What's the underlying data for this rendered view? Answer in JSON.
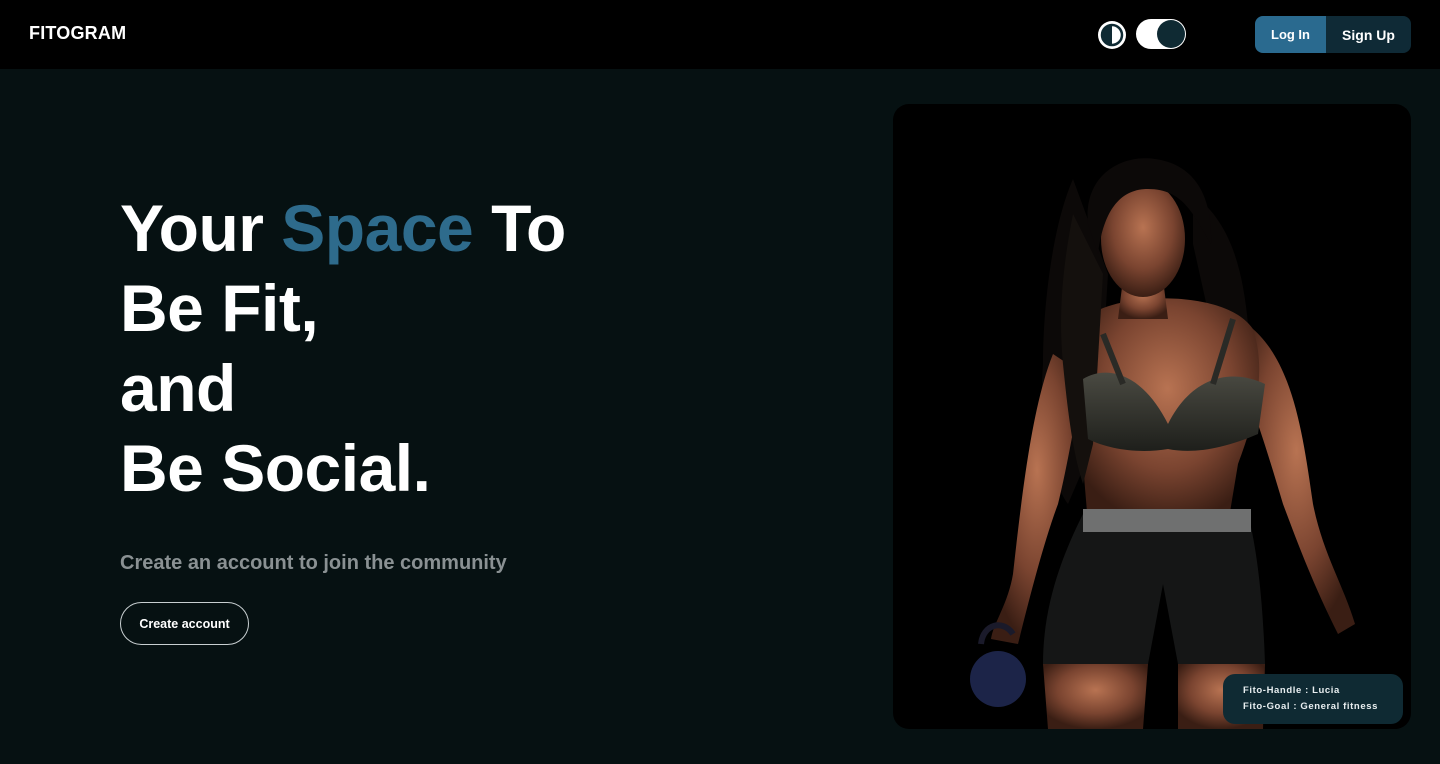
{
  "nav": {
    "brand": "FITOGRAM",
    "login_label": "Log In",
    "signup_label": "Sign Up",
    "icons": [
      "contrast-icon",
      "theme-toggle"
    ]
  },
  "hero": {
    "title_part1": "Your ",
    "title_accent": "Space",
    "title_part2": " To",
    "title_line2": "Be Fit,",
    "title_line3": "and",
    "title_line4": "Be Social.",
    "subtitle": "Create an account to join the community",
    "cta_label": "Create account"
  },
  "profile": {
    "handle_label": "Fito-Handle",
    "handle_value": "Lucia",
    "goal_label": "Fito-Goal",
    "goal_value": "General fitness",
    "separator": " : "
  },
  "colors": {
    "background": "#061112",
    "navbar": "#000000",
    "accent": "#2e6b8c",
    "login_button": "#2a6a8f",
    "signup_button": "#0f2a36",
    "subtitle": "#8a9193",
    "tag_background": "#0f2a33"
  }
}
